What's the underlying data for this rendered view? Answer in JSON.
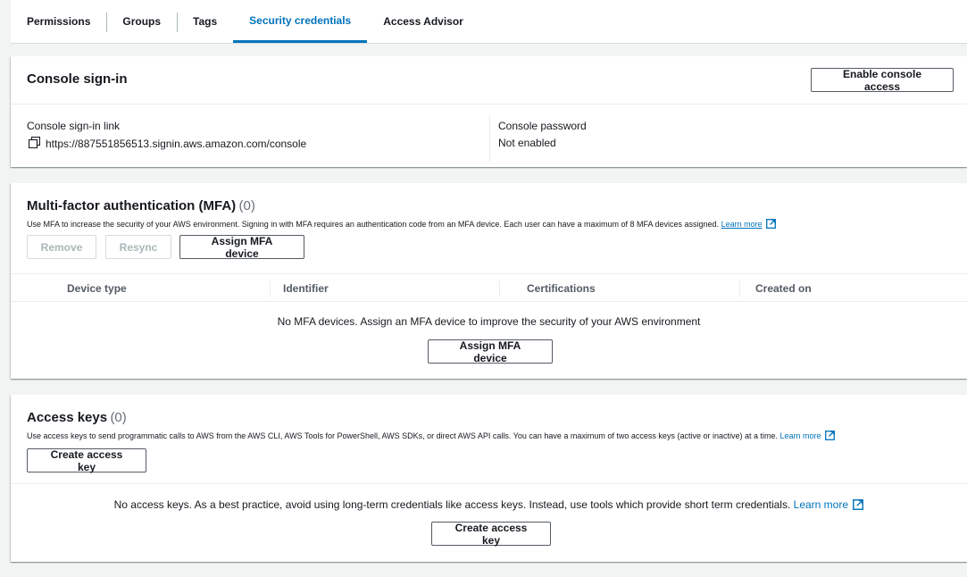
{
  "tabs": [
    {
      "label": "Permissions"
    },
    {
      "label": "Groups"
    },
    {
      "label": "Tags"
    },
    {
      "label": "Security credentials",
      "active": true
    },
    {
      "label": "Access Advisor"
    }
  ],
  "console_signin": {
    "title": "Console sign-in",
    "enable_button": "Enable console access",
    "link_label": "Console sign-in link",
    "link_value": "https://887551856513.signin.aws.amazon.com/console",
    "password_label": "Console password",
    "password_value": "Not enabled"
  },
  "mfa": {
    "title": "Multi-factor authentication (MFA)",
    "count": "(0)",
    "description": "Use MFA to increase the security of your AWS environment. Signing in with MFA requires an authentication code from an MFA device. Each user can have a maximum of 8 MFA devices assigned.",
    "learn_more": "Learn more",
    "remove_button": "Remove",
    "resync_button": "Resync",
    "assign_button": "Assign MFA device",
    "columns": [
      "Device type",
      "Identifier",
      "Certifications",
      "Created on"
    ],
    "empty_message": "No MFA devices. Assign an MFA device to improve the security of your AWS environment",
    "empty_assign_button": "Assign MFA device"
  },
  "access_keys": {
    "title": "Access keys",
    "count": "(0)",
    "description": "Use access keys to send programmatic calls to AWS from the AWS CLI, AWS Tools for PowerShell, AWS SDKs, or direct AWS API calls. You can have a maximum of two access keys (active or inactive) at a time.",
    "learn_more": "Learn more",
    "create_button": "Create access key",
    "empty_message": "No access keys. As a best practice, avoid using long-term credentials like access keys. Instead, use tools which provide short term credentials.",
    "empty_learn_more": "Learn more",
    "empty_create_button": "Create access key"
  },
  "colors": {
    "accent": "#0073bb",
    "background": "#f2f3f3",
    "disabled": "#aab7b8"
  }
}
